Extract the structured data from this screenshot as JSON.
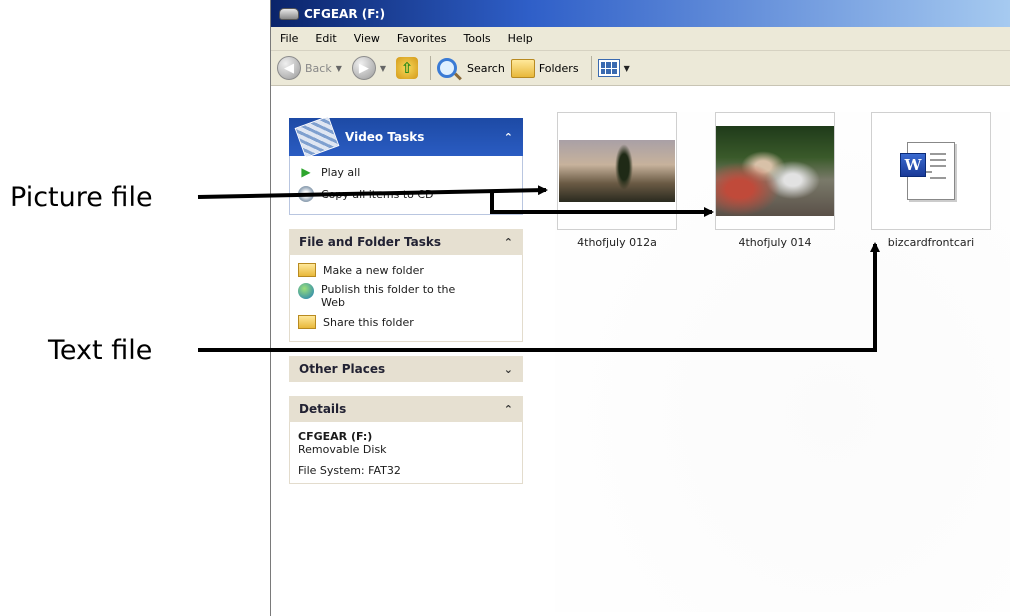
{
  "annotations": {
    "picture_label": "Picture file",
    "text_label": "Text file"
  },
  "window": {
    "title": "CFGEAR (F:)"
  },
  "menu": [
    "File",
    "Edit",
    "View",
    "Favorites",
    "Tools",
    "Help"
  ],
  "toolbar": {
    "back_label": "Back",
    "search_label": "Search",
    "folders_label": "Folders"
  },
  "sidebar": {
    "video_tasks": {
      "title": "Video Tasks",
      "items": [
        "Play all",
        "Copy all items to CD"
      ]
    },
    "file_folder_tasks": {
      "title": "File and Folder Tasks",
      "items": [
        "Make a new folder",
        "Publish this folder to the Web",
        "Share this folder"
      ]
    },
    "other_places": {
      "title": "Other Places"
    },
    "details": {
      "title": "Details",
      "name": "CFGEAR (F:)",
      "type": "Removable Disk",
      "filesystem": "File System: FAT32"
    }
  },
  "files": [
    {
      "name": "4thofjuly 012a",
      "kind": "picture"
    },
    {
      "name": "4thofjuly 014",
      "kind": "picture"
    },
    {
      "name": "bizcardfrontcari",
      "kind": "word-document"
    }
  ],
  "colors": {
    "title_gradient_start": "#0a246a",
    "panel_blue": "#1d4aa5",
    "panel_tan": "#e6e0d1",
    "toolbar_bg": "#ece9d8"
  }
}
